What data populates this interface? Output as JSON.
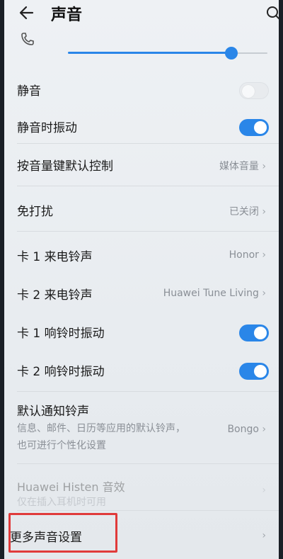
{
  "header": {
    "title": "声音"
  },
  "rows": {
    "mute": {
      "label": "静音",
      "toggle": "off"
    },
    "mute_vibrate": {
      "label": "静音时振动",
      "toggle": "on"
    },
    "volume_key": {
      "label": "按音量键默认控制",
      "value": "媒体音量"
    },
    "dnd": {
      "label": "免打扰",
      "value": "已关闭"
    },
    "sim1_ringtone": {
      "label": "卡 1 来电铃声",
      "value": "Honor"
    },
    "sim2_ringtone": {
      "label": "卡 2 来电铃声",
      "value": "Huawei Tune Living"
    },
    "sim1_vibrate": {
      "label": "卡 1 响铃时振动",
      "toggle": "on"
    },
    "sim2_vibrate": {
      "label": "卡 2 响铃时振动",
      "toggle": "on"
    },
    "notification": {
      "label": "默认通知铃声",
      "sublabel_1": "信息、邮件、日历等应用的默认铃声，",
      "sublabel_2": "也可进行个性化设置",
      "value": "Bongo"
    },
    "histen": {
      "label": "Huawei Histen 音效",
      "sublabel": "仅在插入耳机时可用"
    },
    "more": {
      "label": "更多声音设置"
    }
  },
  "colors": {
    "accent": "#2a86e8",
    "highlight": "#e03a3a"
  }
}
